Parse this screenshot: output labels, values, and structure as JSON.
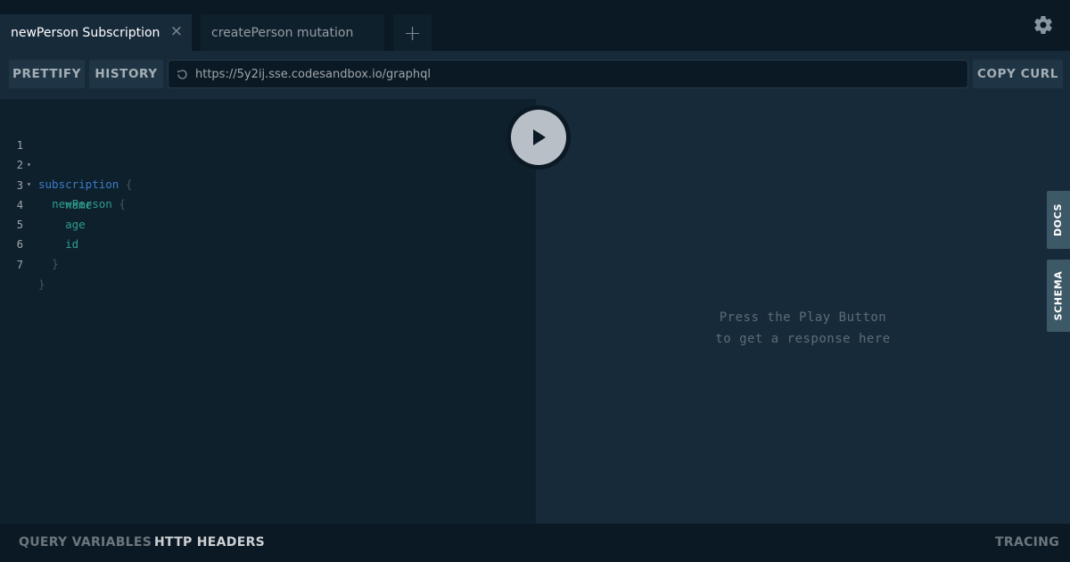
{
  "tabs": {
    "active_label": "newPerson Subscription",
    "close_glyph": "×",
    "inactive_label": "createPerson mutation",
    "add_glyph": "+",
    "settings_icon": "gear-icon"
  },
  "toolbar": {
    "prettify_label": "PRETTIFY",
    "history_label": "HISTORY",
    "endpoint_url": "https://5y2ij.sse.codesandbox.io/graphql",
    "copy_curl_label": "COPY CURL",
    "reload_icon": "reload-icon"
  },
  "editor": {
    "lines": [
      {
        "number": "1",
        "fold": "▾",
        "text": "subscription {"
      },
      {
        "number": "2",
        "fold": "▾",
        "text": "newPerson {"
      },
      {
        "number": "3",
        "fold": "",
        "text": "name"
      },
      {
        "number": "4",
        "fold": "",
        "text": "age"
      },
      {
        "number": "5",
        "fold": "",
        "text": "id"
      },
      {
        "number": "6",
        "fold": "",
        "text": "}"
      },
      {
        "number": "7",
        "fold": "",
        "text": "}"
      }
    ],
    "keyword": "subscription",
    "fields": [
      "newPerson",
      "name",
      "age",
      "id"
    ]
  },
  "play_button": {
    "icon": "play-icon"
  },
  "result": {
    "placeholder_line1": "Press the Play Button",
    "placeholder_line2": "to get a response here"
  },
  "side_tabs": {
    "docs_label": "DOCS",
    "schema_label": "SCHEMA"
  },
  "bottom": {
    "query_variables_label": "QUERY VARIABLES",
    "http_headers_label": "HTTP HEADERS",
    "tracing_label": "TRACING"
  },
  "colors": {
    "background": "#0b1924",
    "editor_bg": "#0f202d",
    "result_bg": "#172a3a",
    "keyword": "#3b7cc6",
    "field": "#2f9c8e",
    "side_tab": "#3d5866"
  }
}
